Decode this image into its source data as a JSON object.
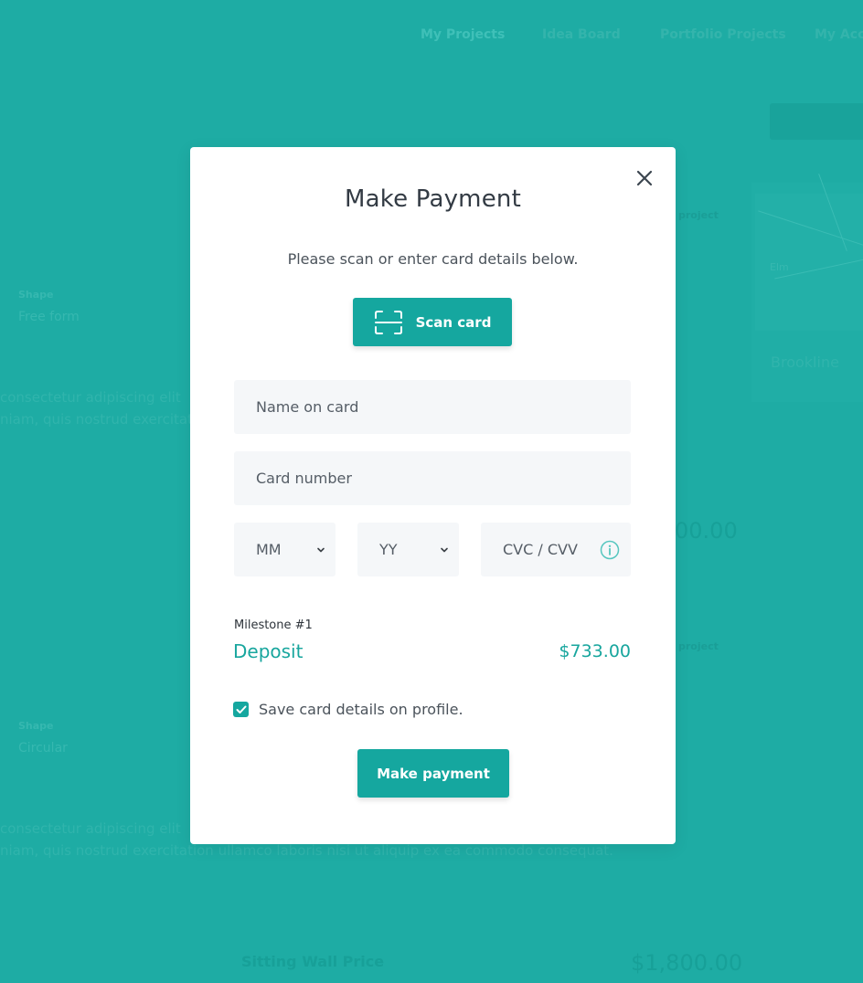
{
  "background": {
    "nav": [
      "My Projects",
      "Idea Board",
      "Portfolio Projects",
      "My Acc"
    ],
    "section1": {
      "shape_label": "Shape",
      "shape_value": "Free form",
      "desc": "consectetur adipiscing elit",
      "desc2": "niam, quis nostrud exercitat",
      "price": "00.00",
      "project_label": "project"
    },
    "section2": {
      "shape_label": "Shape",
      "shape_value": "Circular",
      "desc": "consectetur adipiscing elit",
      "desc2": "niam, quis nostrud exercitation ullamco laboris nisi ut aliquip ex ea commodo consequat.",
      "project_label": "project"
    },
    "right_card_label": "Brookline",
    "map_road": "Elm",
    "footer_label": "Sitting Wall Price",
    "footer_price": "$1,800.00"
  },
  "modal": {
    "title": "Make Payment",
    "subtitle": "Please scan or enter card details below.",
    "scan_button": "Scan card",
    "name_placeholder": "Name on card",
    "number_placeholder": "Card number",
    "month_placeholder": "MM",
    "year_placeholder": "YY",
    "cvc_placeholder": "CVC / CVV",
    "milestone_label": "Milestone #1",
    "milestone_name": "Deposit",
    "milestone_amount": "$733.00",
    "save_card_label": "Save card details on profile.",
    "save_card_checked": true,
    "pay_button": "Make payment"
  },
  "colors": {
    "accent": "#15a79f",
    "overlay": "#1eaca4"
  },
  "icons": {
    "close": "close-icon",
    "scan": "scan-frame-icon",
    "info": "info-icon",
    "chevron": "chevron-down-icon",
    "check": "check-icon"
  }
}
